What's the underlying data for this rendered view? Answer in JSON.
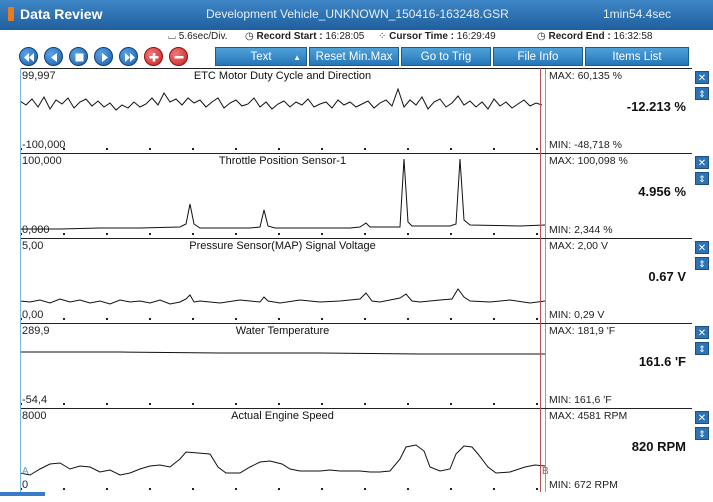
{
  "title": "Data Review",
  "file_name": "Development Vehicle_UNKNOWN_150416-163248.GSR",
  "duration": "1min54.4sec",
  "info": {
    "division": "5.6sec/Div.",
    "record_start_label": "Record Start :",
    "record_start": "16:28:05",
    "cursor_time_label": "Cursor Time :",
    "cursor_time": "16:29:49",
    "record_end_label": "Record End :",
    "record_end": "16:32:58"
  },
  "toolbar": {
    "text_label": "Text",
    "reset_label": "Reset Min.Max",
    "trig_label": "Go to Trig",
    "fileinfo_label": "File Info",
    "items_label": "Items List"
  },
  "icons": [
    "rewind-icon",
    "previous-icon",
    "stop-icon",
    "play-icon",
    "fast-forward-icon",
    "add-icon",
    "remove-icon"
  ],
  "cursor_a": "A",
  "cursor_b": "B",
  "accent": "#2676b8",
  "panels": [
    {
      "title": "ETC Motor Duty Cycle and Direction",
      "ymax": "99,997",
      "ymin": "-100,000",
      "max": "MAX: 60,135 %",
      "min": "MIN: -48,718 %",
      "current": "-12.213 %"
    },
    {
      "title": "Throttle Position Sensor-1",
      "ymax": "100,000",
      "ymin": "0,000",
      "max": "MAX: 100,098 %",
      "min": "MIN: 2,344 %",
      "current": "4.956 %"
    },
    {
      "title": "Pressure Sensor(MAP) Signal Voltage",
      "ymax": "5,00",
      "ymin": "0,00",
      "max": "MAX:  2,00 V",
      "min": "MIN: 0,29 V",
      "current": "0.67 V"
    },
    {
      "title": "Water Temperature",
      "ymax": "289,9",
      "ymin": "-54,4",
      "max": "MAX: 181,9 'F",
      "min": "MIN: 161,6 'F",
      "current": "161.6 'F"
    },
    {
      "title": "Actual Engine Speed",
      "ymax": "8000",
      "ymin": "0",
      "max": "MAX:  4581 RPM",
      "min": "MIN:   672 RPM",
      "current": "820 RPM"
    }
  ]
}
